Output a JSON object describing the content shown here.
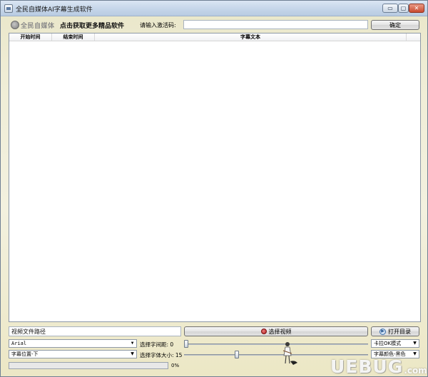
{
  "window": {
    "title": "全民自媒体AI字幕生成软件",
    "controls": {
      "minimize": "▭",
      "maximize": "▢",
      "close": "✕"
    }
  },
  "header": {
    "logo_text": "全民自媒体",
    "promo_link": "点击获取更多精品软件",
    "code_label": "请输入激活码:",
    "code_value": "",
    "confirm_label": "确定"
  },
  "grid": {
    "columns": [
      "开始时间",
      "结束时间",
      "字幕文本"
    ],
    "rows": []
  },
  "controls": {
    "video_path_value": "视频文件路径",
    "select_video_label": "选择视频",
    "open_dir_label": "打开目录",
    "font_select": "Arial",
    "position_select": "字幕位置-下",
    "spacing_label": "选择字间距: 0",
    "spacing_value": 0,
    "size_label": "选择字体大小: 15",
    "size_value": 15,
    "mode_select": "卡拉OK模式",
    "color_select": "字幕颜色-黑色",
    "progress_value": 0,
    "progress_text": "0%"
  },
  "watermark": {
    "main": "UEBUG",
    "suffix": ".com"
  },
  "colors": {
    "progress_fill": "#3d9a2a",
    "close_button": "#c94a2f"
  }
}
